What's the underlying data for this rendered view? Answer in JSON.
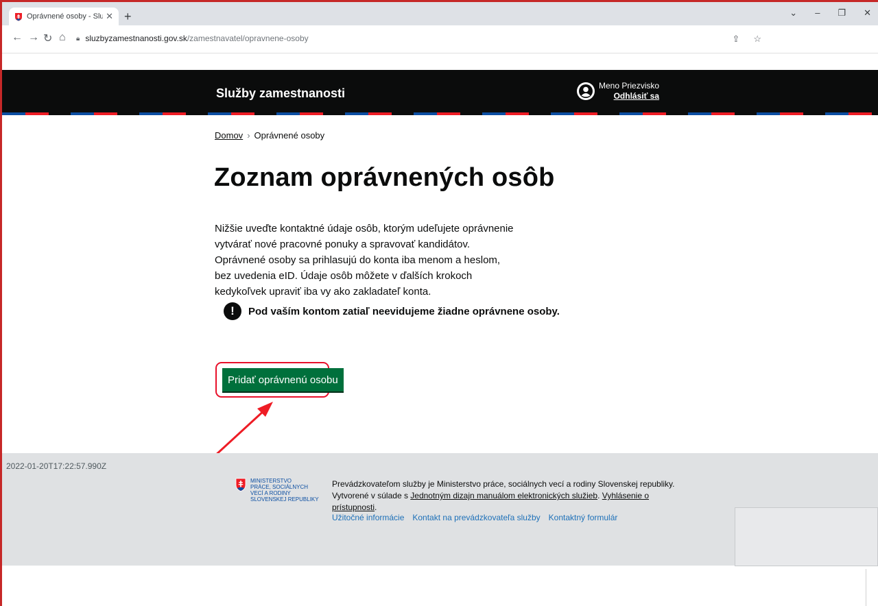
{
  "browser": {
    "tab_title": "Oprávnené osoby - Služby zamest",
    "url_host": "sluzbyzamestnanosti.gov.sk",
    "url_path": "/zamestnavatel/opravnene-osoby"
  },
  "header": {
    "brand": "Služby zamestnanosti",
    "user_name": "Meno Priezvisko",
    "logout_label": "Odhlásiť sa"
  },
  "breadcrumb": {
    "home": "Domov",
    "separator": "›",
    "current": "Oprávnené osoby"
  },
  "main": {
    "title": "Zoznam oprávnených osôb",
    "intro": "Nižšie uveďte kontaktné údaje osôb, ktorým udeľujete oprávnenie vytvárať nové pracovné ponuky a spravovať kandidátov. Oprávnené osoby sa prihlasujú do konta iba menom a heslom, bez uvedenia eID. Údaje osôb môžete v ďalších krokoch kedykoľvek upraviť iba vy ako zakladateľ konta.",
    "notice_icon": "!",
    "notice": "Pod vaším kontom zatiaľ neevidujeme žiadne oprávnene osoby.",
    "add_button": "Pridať oprávnenú osobu"
  },
  "footer": {
    "timestamp": "2022-01-20T17:22:57.990Z",
    "ministry_line1": "MINISTERSTVO",
    "ministry_line2": "PRÁCE, SOCIÁLNYCH",
    "ministry_line3": "VECÍ A RODINY",
    "ministry_line4": "SLOVENSKEJ REPUBLIKY",
    "text_part1": "Prevádzkovateľom služby je Ministerstvo práce, sociálnych vecí a rodiny Slovenskej republiky. Vytvorené v súlade s ",
    "link_manual": "Jednotným dizajn manuálom elektronických služieb",
    "text_part2": ". ",
    "link_accessibility": "Vyhlásenie o prístupnosti",
    "text_part3": ".",
    "links": [
      "Užitočné informácie",
      "Kontakt na prevádzkovateľa služby",
      "Kontaktný formulár"
    ]
  },
  "colors": {
    "header_bg": "#0b0c0c",
    "button_green": "#00703c",
    "highlight_red": "#e8102a",
    "footer_bg": "#dfe1e3",
    "link_blue": "#1d70b8"
  }
}
